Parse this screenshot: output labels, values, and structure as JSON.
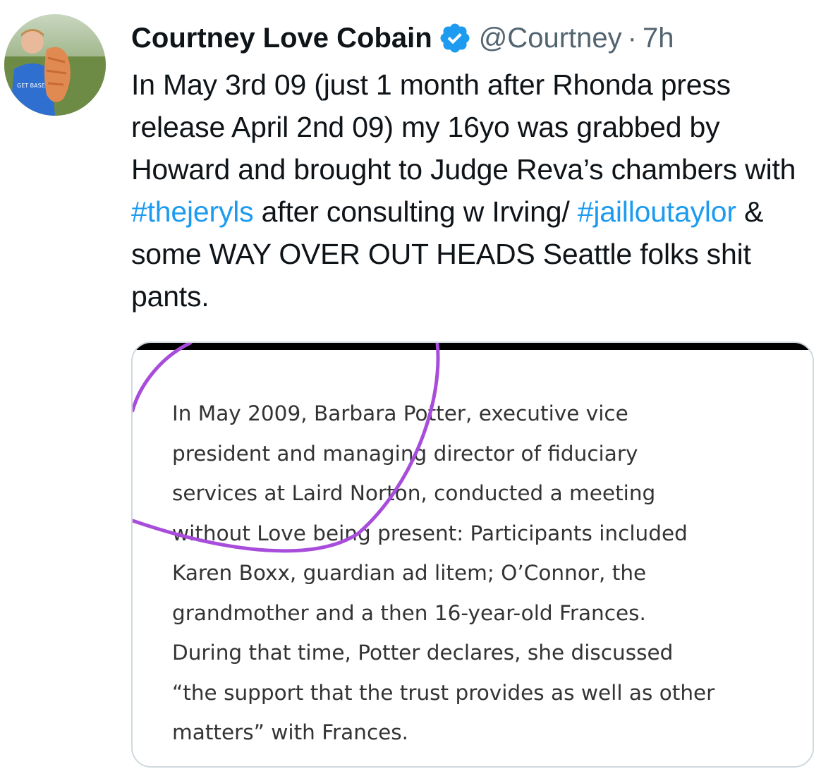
{
  "tweet": {
    "display_name": "Courtney Love Cobain",
    "verified_icon": "verified-badge-icon",
    "handle": "@Courtney",
    "separator": "·",
    "time": "7h",
    "text": {
      "part1": "In May 3rd 09 (just 1 month after Rhonda press release April 2nd 09) my 16yo was grabbed by Howard and brought to Judge Reva’s chambers with ",
      "hashtag1": "#thejeryls",
      "part2": " after consulting w Irving/ ",
      "hashtag2": "#jailloutaylor",
      "part3": " & some WAY OVER OUT HEADS Seattle folks shit pants."
    },
    "colors": {
      "hashtag": "#1d9bf0",
      "verified": "#1d9bf0",
      "secondary_text": "#536471",
      "annotation_circle": "#a84ddb"
    },
    "media": {
      "lines": [
        "In May 2009, Barbara Potter, executive vice",
        "president and managing director of fiduciary",
        "services at Laird Norton, conducted a meeting",
        "without Love being present:  Participants included",
        "Karen Boxx, guardian ad litem;  O’Connor, the",
        "grandmother and a then 16-year-old Frances.",
        "During that time,  Potter declares, she discussed",
        "“the support that the trust provides as well as other",
        "matters” with Frances."
      ]
    }
  }
}
